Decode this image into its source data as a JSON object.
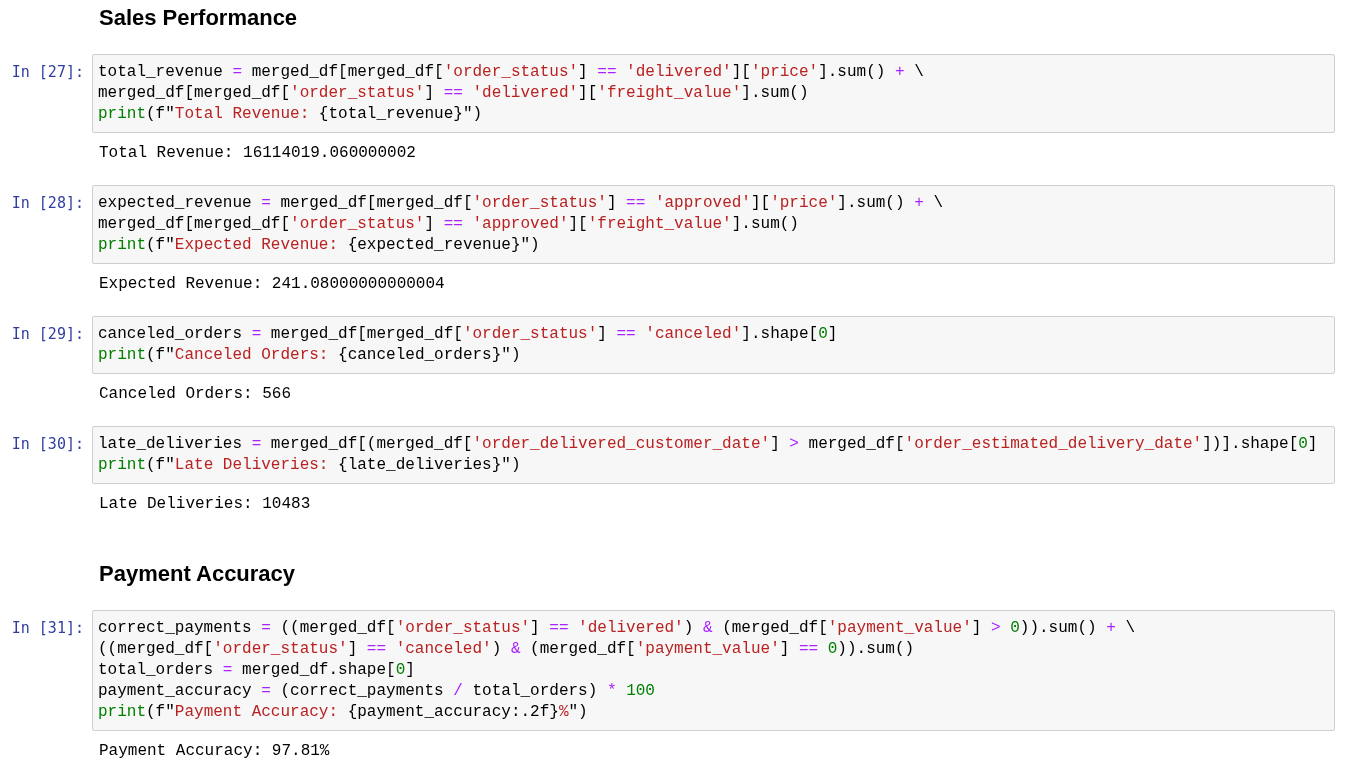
{
  "cells": [
    {
      "kind": "heading",
      "text": "Sales Performance"
    },
    {
      "kind": "code",
      "prompt": "In [27]:",
      "lines": [
        [
          {
            "kind": "plain",
            "text": "total_revenue "
          },
          {
            "kind": "op",
            "text": "="
          },
          {
            "kind": "plain",
            "text": " merged_df[merged_df["
          },
          {
            "kind": "str",
            "text": "'order_status'"
          },
          {
            "kind": "plain",
            "text": "] "
          },
          {
            "kind": "op",
            "text": "=="
          },
          {
            "kind": "str",
            "text": " 'delivered'"
          },
          {
            "kind": "plain",
            "text": "]["
          },
          {
            "kind": "str",
            "text": "'price'"
          },
          {
            "kind": "plain",
            "text": "].sum() "
          },
          {
            "kind": "op",
            "text": "+"
          },
          {
            "kind": "plain",
            "text": " \\"
          }
        ],
        [
          {
            "kind": "plain",
            "text": "merged_df[merged_df["
          },
          {
            "kind": "str",
            "text": "'order_status'"
          },
          {
            "kind": "plain",
            "text": "] "
          },
          {
            "kind": "op",
            "text": "=="
          },
          {
            "kind": "str",
            "text": " 'delivered'"
          },
          {
            "kind": "plain",
            "text": "]["
          },
          {
            "kind": "str",
            "text": "'freight_value'"
          },
          {
            "kind": "plain",
            "text": "].sum()"
          }
        ],
        [
          {
            "kind": "builtin",
            "text": "print"
          },
          {
            "kind": "plain",
            "text": "(f\""
          },
          {
            "kind": "str",
            "text": "Total Revenue: "
          },
          {
            "kind": "plain",
            "text": "{total_revenue}\")"
          }
        ]
      ],
      "output": "Total Revenue: 16114019.060000002"
    },
    {
      "kind": "code",
      "prompt": "In [28]:",
      "lines": [
        [
          {
            "kind": "plain",
            "text": "expected_revenue "
          },
          {
            "kind": "op",
            "text": "="
          },
          {
            "kind": "plain",
            "text": " merged_df[merged_df["
          },
          {
            "kind": "str",
            "text": "'order_status'"
          },
          {
            "kind": "plain",
            "text": "] "
          },
          {
            "kind": "op",
            "text": "=="
          },
          {
            "kind": "str",
            "text": " 'approved'"
          },
          {
            "kind": "plain",
            "text": "]["
          },
          {
            "kind": "str",
            "text": "'price'"
          },
          {
            "kind": "plain",
            "text": "].sum() "
          },
          {
            "kind": "op",
            "text": "+"
          },
          {
            "kind": "plain",
            "text": " \\"
          }
        ],
        [
          {
            "kind": "plain",
            "text": "merged_df[merged_df["
          },
          {
            "kind": "str",
            "text": "'order_status'"
          },
          {
            "kind": "plain",
            "text": "] "
          },
          {
            "kind": "op",
            "text": "=="
          },
          {
            "kind": "str",
            "text": " 'approved'"
          },
          {
            "kind": "plain",
            "text": "]["
          },
          {
            "kind": "str",
            "text": "'freight_value'"
          },
          {
            "kind": "plain",
            "text": "].sum()"
          }
        ],
        [
          {
            "kind": "builtin",
            "text": "print"
          },
          {
            "kind": "plain",
            "text": "(f\""
          },
          {
            "kind": "str",
            "text": "Expected Revenue: "
          },
          {
            "kind": "plain",
            "text": "{expected_revenue}\")"
          }
        ]
      ],
      "output": "Expected Revenue: 241.08000000000004"
    },
    {
      "kind": "code",
      "prompt": "In [29]:",
      "lines": [
        [
          {
            "kind": "plain",
            "text": "canceled_orders "
          },
          {
            "kind": "op",
            "text": "="
          },
          {
            "kind": "plain",
            "text": " merged_df[merged_df["
          },
          {
            "kind": "str",
            "text": "'order_status'"
          },
          {
            "kind": "plain",
            "text": "] "
          },
          {
            "kind": "op",
            "text": "=="
          },
          {
            "kind": "str",
            "text": " 'canceled'"
          },
          {
            "kind": "plain",
            "text": "].shape["
          },
          {
            "kind": "num",
            "text": "0"
          },
          {
            "kind": "plain",
            "text": "]"
          }
        ],
        [
          {
            "kind": "builtin",
            "text": "print"
          },
          {
            "kind": "plain",
            "text": "(f\""
          },
          {
            "kind": "str",
            "text": "Canceled Orders: "
          },
          {
            "kind": "plain",
            "text": "{canceled_orders}\")"
          }
        ]
      ],
      "output": "Canceled Orders: 566"
    },
    {
      "kind": "code",
      "prompt": "In [30]:",
      "lines": [
        [
          {
            "kind": "plain",
            "text": "late_deliveries "
          },
          {
            "kind": "op",
            "text": "="
          },
          {
            "kind": "plain",
            "text": " merged_df[(merged_df["
          },
          {
            "kind": "str",
            "text": "'order_delivered_customer_date'"
          },
          {
            "kind": "plain",
            "text": "] "
          },
          {
            "kind": "op",
            "text": ">"
          },
          {
            "kind": "plain",
            "text": " merged_df["
          },
          {
            "kind": "str",
            "text": "'order_estimated_delivery_date'"
          },
          {
            "kind": "plain",
            "text": "])].shape["
          },
          {
            "kind": "num",
            "text": "0"
          },
          {
            "kind": "plain",
            "text": "]"
          }
        ],
        [
          {
            "kind": "builtin",
            "text": "print"
          },
          {
            "kind": "plain",
            "text": "(f\""
          },
          {
            "kind": "str",
            "text": "Late Deliveries: "
          },
          {
            "kind": "plain",
            "text": "{late_deliveries}\")"
          }
        ]
      ],
      "output": "Late Deliveries: 10483"
    },
    {
      "kind": "heading",
      "text": "Payment Accuracy"
    },
    {
      "kind": "code",
      "prompt": "In [31]:",
      "lines": [
        [
          {
            "kind": "plain",
            "text": "correct_payments "
          },
          {
            "kind": "op",
            "text": "="
          },
          {
            "kind": "plain",
            "text": " ((merged_df["
          },
          {
            "kind": "str",
            "text": "'order_status'"
          },
          {
            "kind": "plain",
            "text": "] "
          },
          {
            "kind": "op",
            "text": "=="
          },
          {
            "kind": "str",
            "text": " 'delivered'"
          },
          {
            "kind": "plain",
            "text": ") "
          },
          {
            "kind": "op",
            "text": "&"
          },
          {
            "kind": "plain",
            "text": " (merged_df["
          },
          {
            "kind": "str",
            "text": "'payment_value'"
          },
          {
            "kind": "plain",
            "text": "] "
          },
          {
            "kind": "op",
            "text": ">"
          },
          {
            "kind": "num",
            "text": " 0"
          },
          {
            "kind": "plain",
            "text": ")).sum() "
          },
          {
            "kind": "op",
            "text": "+"
          },
          {
            "kind": "plain",
            "text": " \\"
          }
        ],
        [
          {
            "kind": "plain",
            "text": "((merged_df["
          },
          {
            "kind": "str",
            "text": "'order_status'"
          },
          {
            "kind": "plain",
            "text": "] "
          },
          {
            "kind": "op",
            "text": "=="
          },
          {
            "kind": "str",
            "text": " 'canceled'"
          },
          {
            "kind": "plain",
            "text": ") "
          },
          {
            "kind": "op",
            "text": "&"
          },
          {
            "kind": "plain",
            "text": " (merged_df["
          },
          {
            "kind": "str",
            "text": "'payment_value'"
          },
          {
            "kind": "plain",
            "text": "] "
          },
          {
            "kind": "op",
            "text": "=="
          },
          {
            "kind": "num",
            "text": " 0"
          },
          {
            "kind": "plain",
            "text": ")).sum()"
          }
        ],
        [
          {
            "kind": "plain",
            "text": "total_orders "
          },
          {
            "kind": "op",
            "text": "="
          },
          {
            "kind": "plain",
            "text": " merged_df.shape["
          },
          {
            "kind": "num",
            "text": "0"
          },
          {
            "kind": "plain",
            "text": "]"
          }
        ],
        [
          {
            "kind": "plain",
            "text": "payment_accuracy "
          },
          {
            "kind": "op",
            "text": "="
          },
          {
            "kind": "plain",
            "text": " (correct_payments "
          },
          {
            "kind": "op",
            "text": "/"
          },
          {
            "kind": "plain",
            "text": " total_orders) "
          },
          {
            "kind": "op",
            "text": "*"
          },
          {
            "kind": "num",
            "text": " 100"
          }
        ],
        [
          {
            "kind": "builtin",
            "text": "print"
          },
          {
            "kind": "plain",
            "text": "(f\""
          },
          {
            "kind": "str",
            "text": "Payment Accuracy: "
          },
          {
            "kind": "plain",
            "text": "{payment_accuracy:.2f}"
          },
          {
            "kind": "str",
            "text": "%"
          },
          {
            "kind": "plain",
            "text": "\")"
          }
        ]
      ],
      "output": "Payment Accuracy: 97.81%"
    }
  ]
}
